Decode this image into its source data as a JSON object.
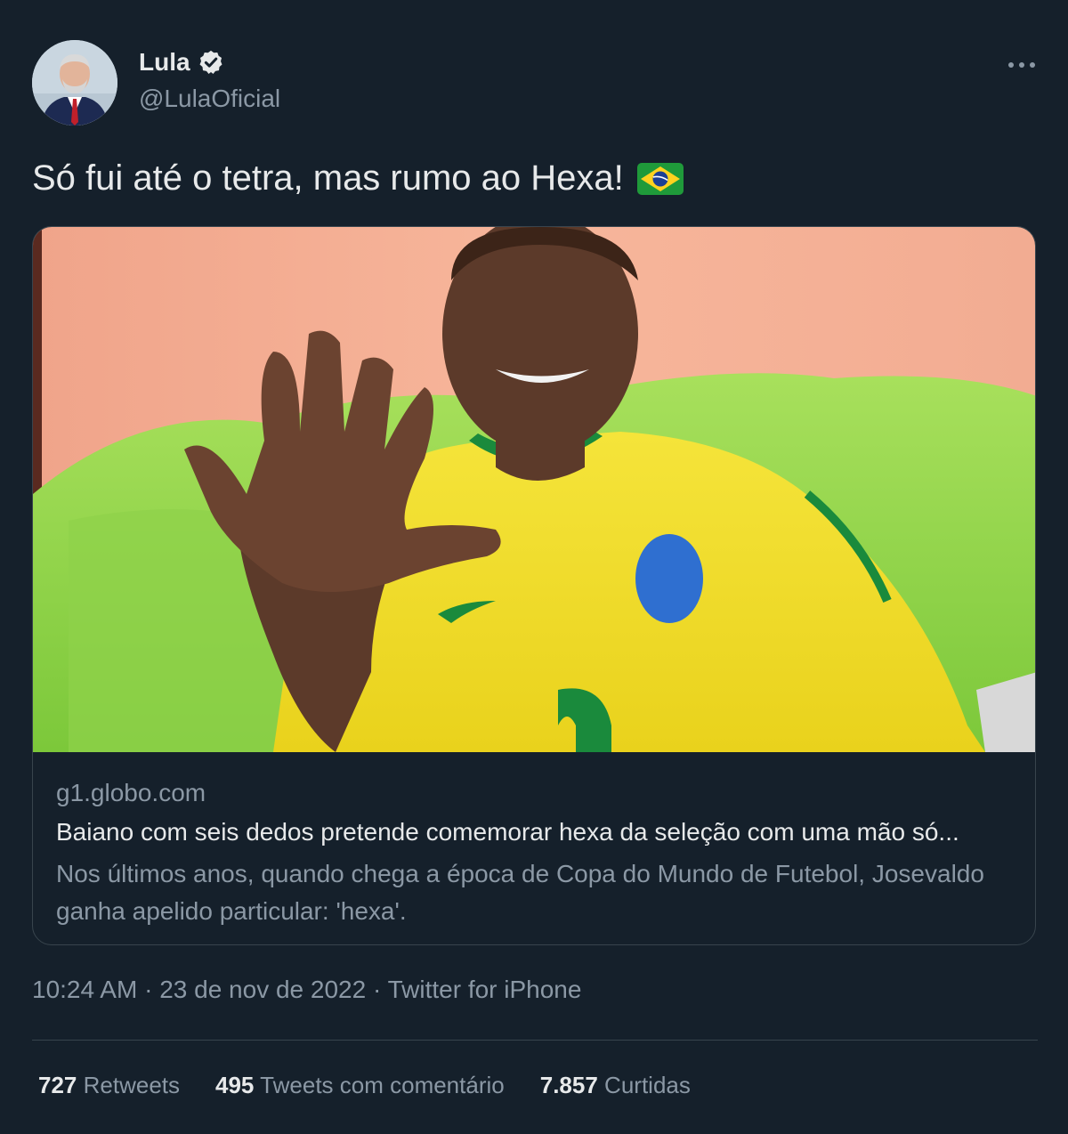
{
  "author": {
    "name": "Lula",
    "handle": "@LulaOficial",
    "verified": true,
    "avatar_icon": "avatar-photo"
  },
  "tweet": {
    "text": "Só fui até o tetra, mas rumo ao Hexa!",
    "emoji": "brazil-flag-icon"
  },
  "card": {
    "image": "photo-man-showing-six-fingers-brazil-jersey",
    "domain": "g1.globo.com",
    "title": "Baiano com seis dedos pretende comemorar hexa da seleção com uma mão só...",
    "description": "Nos últimos anos, quando chega a época de Copa do Mundo de Futebol, Josevaldo ganha apelido particular: 'hexa'."
  },
  "meta": {
    "time": "10:24 AM",
    "separator": "·",
    "date": "23 de nov de 2022",
    "source": "Twitter for iPhone"
  },
  "stats": {
    "retweets_count": "727",
    "retweets_label": "Retweets",
    "quotes_count": "495",
    "quotes_label": "Tweets com comentário",
    "likes_count": "7.857",
    "likes_label": "Curtidas"
  },
  "colors": {
    "background": "#15202b",
    "text_primary": "#e7e9ea",
    "text_secondary": "#8b98a5",
    "border": "#38444d"
  }
}
